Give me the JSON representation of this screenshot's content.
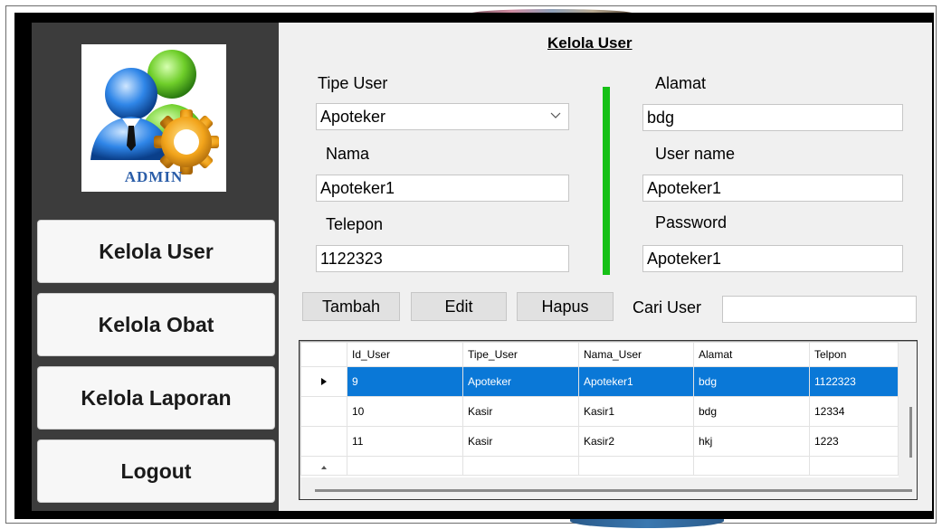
{
  "sidebar": {
    "logo_text": "ADMIN",
    "nav": [
      {
        "label": "Kelola User"
      },
      {
        "label": "Kelola Obat"
      },
      {
        "label": "Kelola Laporan"
      },
      {
        "label": "Logout"
      }
    ]
  },
  "form": {
    "title": "Kelola User",
    "tipe_user_label": "Tipe User",
    "tipe_user_value": "Apoteker",
    "nama_label": "Nama",
    "nama_value": "Apoteker1",
    "telepon_label": "Telepon",
    "telepon_value": "1122323",
    "alamat_label": "Alamat",
    "alamat_value": "bdg",
    "username_label": "User name",
    "username_value": "Apoteker1",
    "password_label": "Password",
    "password_value": "Apoteker1"
  },
  "actions": {
    "tambah": "Tambah",
    "edit": "Edit",
    "hapus": "Hapus",
    "cari_label": "Cari User",
    "cari_value": ""
  },
  "grid": {
    "columns": [
      "Id_User",
      "Tipe_User",
      "Nama_User",
      "Alamat",
      "Telpon"
    ],
    "rows": [
      {
        "selected": true,
        "cells": [
          "9",
          "Apoteker",
          "Apoteker1",
          "bdg",
          "1122323"
        ]
      },
      {
        "selected": false,
        "cells": [
          "10",
          "Kasir",
          "Kasir1",
          "bdg",
          "12334"
        ]
      },
      {
        "selected": false,
        "cells": [
          "11",
          "Kasir",
          "Kasir2",
          "hkj",
          "1223"
        ]
      }
    ]
  },
  "icons": {
    "logo": "admin-users-gear-icon",
    "combo": "chevron-down-icon",
    "row_pointer": "row-pointer-icon"
  },
  "colors": {
    "sidebar_bg": "#3c3c3c",
    "panel_bg": "#f0f0f0",
    "divider": "#16c016",
    "selection": "#0a78d7",
    "logo_text": "#2a5da8"
  }
}
